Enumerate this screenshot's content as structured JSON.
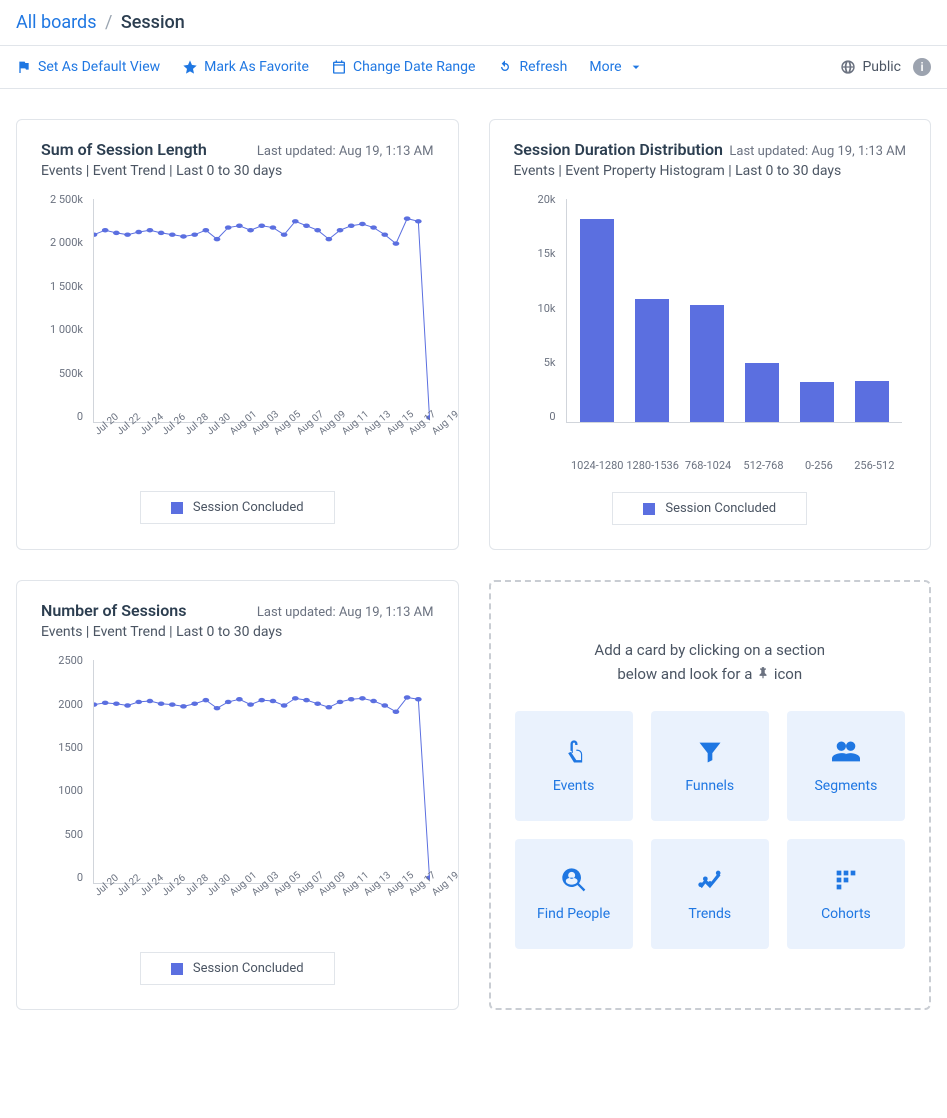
{
  "breadcrumb": {
    "root": "All boards",
    "current": "Session"
  },
  "toolbar": {
    "set_default": "Set As Default View",
    "favorite": "Mark As Favorite",
    "date_range": "Change Date Range",
    "refresh": "Refresh",
    "more": "More",
    "public": "Public"
  },
  "cards": {
    "sum_len": {
      "title": "Sum of Session Length",
      "updated": "Last updated: Aug 19, 1:13 AM",
      "sub": "Events | Event Trend | Last 0 to 30 days",
      "legend": "Session Concluded"
    },
    "dist": {
      "title": "Session Duration Distribution",
      "updated": "Last updated: Aug 19, 1:13 AM",
      "sub": "Events | Event Property Histogram | Last 0 to 30 days",
      "legend": "Session Concluded"
    },
    "num_sess": {
      "title": "Number of Sessions",
      "updated": "Last updated: Aug 19, 1:13 AM",
      "sub": "Events | Event Trend | Last 0 to 30 days",
      "legend": "Session Concluded"
    }
  },
  "add_panel": {
    "line1": "Add a card by clicking on a section",
    "line2_a": "below and look for a ",
    "line2_b": " icon",
    "tiles": {
      "events": "Events",
      "funnels": "Funnels",
      "segments": "Segments",
      "find_people": "Find People",
      "trends": "Trends",
      "cohorts": "Cohorts"
    }
  },
  "chart_data": [
    {
      "id": "sum_len",
      "type": "line",
      "title": "Sum of Session Length",
      "xlabel": "",
      "ylabel": "",
      "ylim": [
        0,
        2500000
      ],
      "y_ticks": [
        "2 500k",
        "2 000k",
        "1 500k",
        "1 000k",
        "500k",
        "0"
      ],
      "x_ticks": [
        "Jul 20",
        "Jul 22",
        "Jul 24",
        "Jul 26",
        "Jul 28",
        "Jul 30",
        "Aug 01",
        "Aug 03",
        "Aug 05",
        "Aug 07",
        "Aug 09",
        "Aug 11",
        "Aug 13",
        "Aug 15",
        "Aug 17",
        "Aug 19"
      ],
      "series": [
        {
          "name": "Session Concluded",
          "x": [
            "Jul 20",
            "Jul 21",
            "Jul 22",
            "Jul 23",
            "Jul 24",
            "Jul 25",
            "Jul 26",
            "Jul 27",
            "Jul 28",
            "Jul 29",
            "Jul 30",
            "Jul 31",
            "Aug 01",
            "Aug 02",
            "Aug 03",
            "Aug 04",
            "Aug 05",
            "Aug 06",
            "Aug 07",
            "Aug 08",
            "Aug 09",
            "Aug 10",
            "Aug 11",
            "Aug 12",
            "Aug 13",
            "Aug 14",
            "Aug 15",
            "Aug 16",
            "Aug 17",
            "Aug 18",
            "Aug 19"
          ],
          "values": [
            2100000,
            2150000,
            2120000,
            2100000,
            2130000,
            2150000,
            2120000,
            2100000,
            2080000,
            2100000,
            2150000,
            2050000,
            2180000,
            2200000,
            2150000,
            2200000,
            2180000,
            2100000,
            2250000,
            2200000,
            2150000,
            2050000,
            2150000,
            2200000,
            2220000,
            2180000,
            2100000,
            2000000,
            2280000,
            2250000,
            50000
          ]
        }
      ]
    },
    {
      "id": "dist",
      "type": "bar",
      "title": "Session Duration Distribution",
      "xlabel": "",
      "ylabel": "",
      "ylim": [
        0,
        20000
      ],
      "y_ticks": [
        "20k",
        "15k",
        "10k",
        "5k",
        "0"
      ],
      "categories": [
        "1024-1280",
        "1280-1536",
        "768-1024",
        "512-768",
        "0-256",
        "256-512"
      ],
      "series": [
        {
          "name": "Session Concluded",
          "values": [
            18200,
            11000,
            10500,
            5300,
            3600,
            3700
          ]
        }
      ]
    },
    {
      "id": "num_sess",
      "type": "line",
      "title": "Number of Sessions",
      "xlabel": "",
      "ylabel": "",
      "ylim": [
        0,
        2500
      ],
      "y_ticks": [
        "2500",
        "2000",
        "1500",
        "1000",
        "500",
        "0"
      ],
      "x_ticks": [
        "Jul 20",
        "Jul 22",
        "Jul 24",
        "Jul 26",
        "Jul 28",
        "Jul 30",
        "Aug 01",
        "Aug 03",
        "Aug 05",
        "Aug 07",
        "Aug 09",
        "Aug 11",
        "Aug 13",
        "Aug 15",
        "Aug 17",
        "Aug 19"
      ],
      "series": [
        {
          "name": "Session Concluded",
          "x": [
            "Jul 20",
            "Jul 21",
            "Jul 22",
            "Jul 23",
            "Jul 24",
            "Jul 25",
            "Jul 26",
            "Jul 27",
            "Jul 28",
            "Jul 29",
            "Jul 30",
            "Jul 31",
            "Aug 01",
            "Aug 02",
            "Aug 03",
            "Aug 04",
            "Aug 05",
            "Aug 06",
            "Aug 07",
            "Aug 08",
            "Aug 09",
            "Aug 10",
            "Aug 11",
            "Aug 12",
            "Aug 13",
            "Aug 14",
            "Aug 15",
            "Aug 16",
            "Aug 17",
            "Aug 18",
            "Aug 19"
          ],
          "values": [
            2000,
            2020,
            2010,
            1990,
            2030,
            2040,
            2010,
            2000,
            1980,
            2010,
            2050,
            1960,
            2030,
            2060,
            2000,
            2050,
            2040,
            1990,
            2070,
            2050,
            2010,
            1970,
            2030,
            2060,
            2070,
            2040,
            1990,
            1920,
            2080,
            2060,
            60
          ]
        }
      ]
    }
  ]
}
